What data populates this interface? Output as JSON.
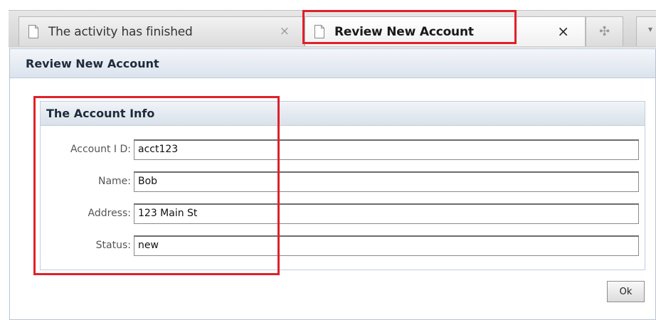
{
  "tabs": [
    {
      "label": "The activity has finished",
      "active": false,
      "close": "×"
    },
    {
      "label": "Review New Account",
      "active": true,
      "close": "×"
    }
  ],
  "tab_add_glyph": "✣",
  "tab_menu_glyph": "▾",
  "panel": {
    "title": "Review New Account"
  },
  "account_info": {
    "title": "The Account Info",
    "fields": [
      {
        "label": "Account I D:",
        "value": "acct123"
      },
      {
        "label": "Name:",
        "value": "Bob"
      },
      {
        "label": "Address:",
        "value": "123 Main St"
      },
      {
        "label": "Status:",
        "value": "new"
      }
    ]
  },
  "ok_label": "Ok",
  "colors": {
    "highlight": "#e0202a",
    "header_gradient_top": "#f3f6fa",
    "header_gradient_bottom": "#dbe3ed"
  },
  "icons": {
    "tab_icon": "document-icon",
    "close": "close-icon",
    "add": "add-tab-icon",
    "menu": "tab-menu-icon"
  }
}
